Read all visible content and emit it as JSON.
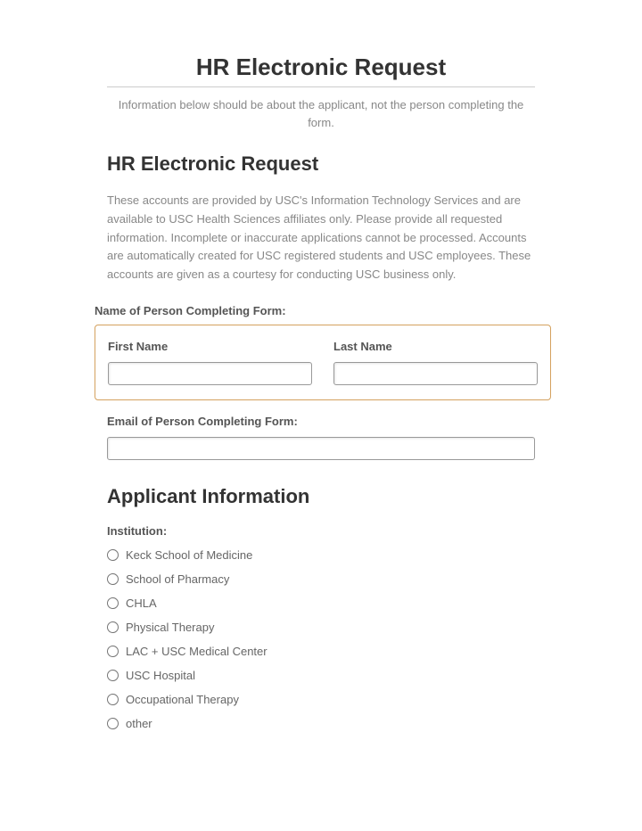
{
  "header": {
    "title": "HR Electronic Request",
    "subtitle": "Information below should be about the applicant, not the person completing the form."
  },
  "form": {
    "sectionTitle": "HR Electronic Request",
    "description": "These accounts are provided by USC's Information Technology Services and are available to USC Health Sciences affiliates only. Please provide all requested information. Incomplete or inaccurate applications cannot be processed. Accounts are automatically created for USC registered students and USC employees. These accounts are given as a courtesy for conducting USC business only.",
    "nameLabel": "Name of Person Completing Form:",
    "firstName": {
      "label": "First Name",
      "value": ""
    },
    "lastName": {
      "label": "Last Name",
      "value": ""
    },
    "email": {
      "label": "Email of Person Completing Form:",
      "value": ""
    }
  },
  "applicant": {
    "sectionTitle": "Applicant Information",
    "institution": {
      "label": "Institution:",
      "options": [
        "Keck School of Medicine",
        "School of Pharmacy",
        "CHLA",
        "Physical Therapy",
        "LAC + USC Medical Center",
        "USC Hospital",
        "Occupational Therapy",
        "other"
      ]
    }
  }
}
